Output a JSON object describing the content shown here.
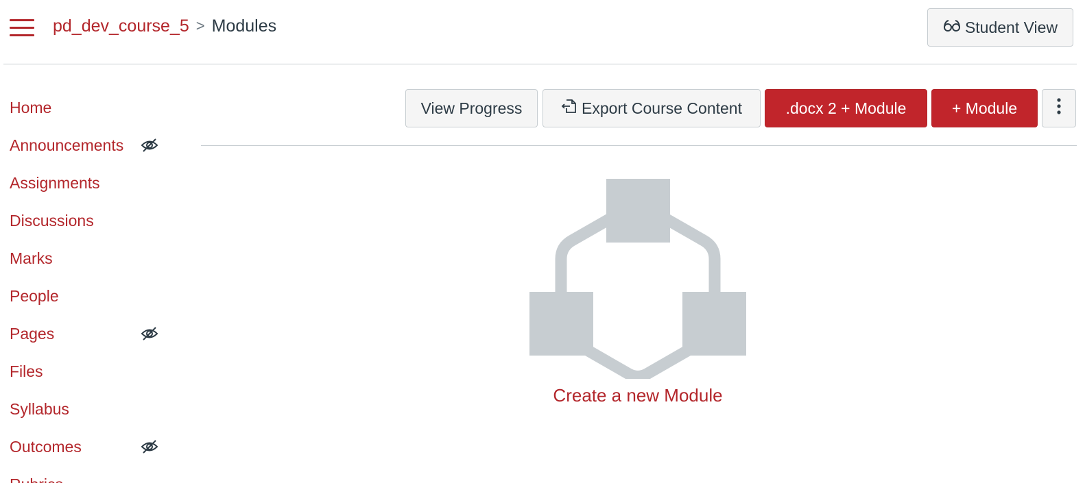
{
  "header": {
    "menu_icon": "hamburger-icon",
    "breadcrumb": {
      "course": "pd_dev_course_5",
      "separator": ">",
      "current": "Modules"
    },
    "student_view_label": "Student View",
    "student_view_icon": "glasses-icon"
  },
  "sidebar": {
    "items": [
      {
        "label": "Home",
        "hidden": false
      },
      {
        "label": "Announcements",
        "hidden": true
      },
      {
        "label": "Assignments",
        "hidden": false
      },
      {
        "label": "Discussions",
        "hidden": false
      },
      {
        "label": "Marks",
        "hidden": false
      },
      {
        "label": "People",
        "hidden": false
      },
      {
        "label": "Pages",
        "hidden": true
      },
      {
        "label": "Files",
        "hidden": false
      },
      {
        "label": "Syllabus",
        "hidden": false
      },
      {
        "label": "Outcomes",
        "hidden": true
      },
      {
        "label": "Rubrics",
        "hidden": false
      }
    ],
    "hidden_icon": "eye-slash-icon"
  },
  "toolbar": {
    "view_progress_label": "View Progress",
    "export_label": "Export Course Content",
    "export_icon": "export-icon",
    "docx_module_label": ".docx 2 + Module",
    "add_module_label": "+ Module",
    "more_icon": "kebab-menu-icon"
  },
  "empty_state": {
    "illustration": "modules-illustration",
    "create_label": "Create a new Module"
  },
  "colors": {
    "brand_red": "#b3262b",
    "button_red": "#c1252b",
    "text_dark": "#2d3b45",
    "illustration_gray": "#c7cdd1"
  }
}
